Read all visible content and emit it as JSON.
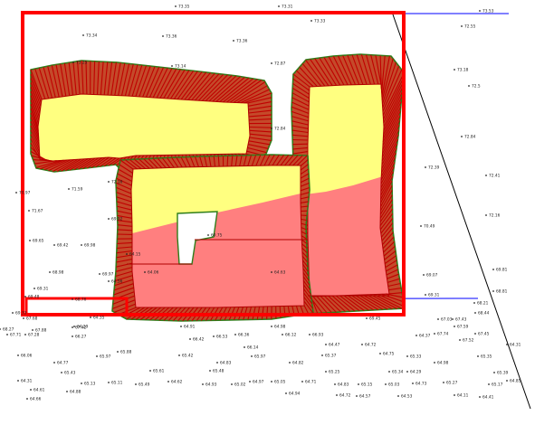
{
  "colors": {
    "background": "#ffffff",
    "boundary": "#ff0000",
    "fill_cut": "#ff7f7f",
    "fill_fill": "#ffff80",
    "hatch": "#c00000",
    "daylight_edge": "#2e7d1a",
    "axis_line": "#0000ff",
    "diagonal_line": "#000000",
    "label_text": "#222222"
  },
  "icons": {
    "point_marker": "dot-icon"
  },
  "spot_levels": [
    "73.35",
    "73.31",
    "73.33",
    "73.53",
    "72.55",
    "73.34",
    "73.36",
    "73.36",
    "73.18",
    "73.25",
    "73.14",
    "72.87",
    "72.5",
    "72.84",
    "72.84",
    "72.16",
    "72.39",
    "72.41",
    "71.59",
    "70.97",
    "71.67",
    "69.92",
    "70.49",
    "72.16",
    "69.65",
    "69.42",
    "69.98",
    "69.75",
    "69.07",
    "69.81",
    "69.97",
    "68.98",
    "69.31",
    "69.31",
    "68.81",
    "69.48",
    "68.76",
    "69.33",
    "68.21",
    "68.44",
    "69.45",
    "67.03",
    "67.43",
    "67.68",
    "67.42",
    "68.27",
    "67.88",
    "67.71",
    "67.28",
    "67.59",
    "67.74",
    "67.45",
    "67.52",
    "66.27",
    "66.42",
    "66.53",
    "66.36",
    "66.12",
    "66.93",
    "66.14",
    "65.88",
    "66.06",
    "65.97",
    "65.42",
    "65.97",
    "65.37",
    "65.33",
    "65.35",
    "65.61",
    "65.48",
    "65.43",
    "65.39",
    "65.34",
    "65.25",
    "65.27",
    "65.17",
    "65.02",
    "65.05",
    "65.13",
    "65.11",
    "65.49",
    "64.62",
    "64.93",
    "64.97",
    "64.71",
    "64.83",
    "65.15",
    "65.03",
    "64.73",
    "64.61",
    "64.88",
    "64.94",
    "64.72",
    "64.57",
    "64.53",
    "64.41",
    "64.11",
    "64.29",
    "64.63",
    "64.56",
    "64.15",
    "64.06",
    "64.47",
    "64.72",
    "64.82",
    "64.98",
    "64.77",
    "64.31",
    "64.85",
    "64.37",
    "64.35",
    "64.91",
    "64.98",
    "64.75",
    "64.29",
    "64.83",
    "64.31",
    "64.66"
  ]
}
